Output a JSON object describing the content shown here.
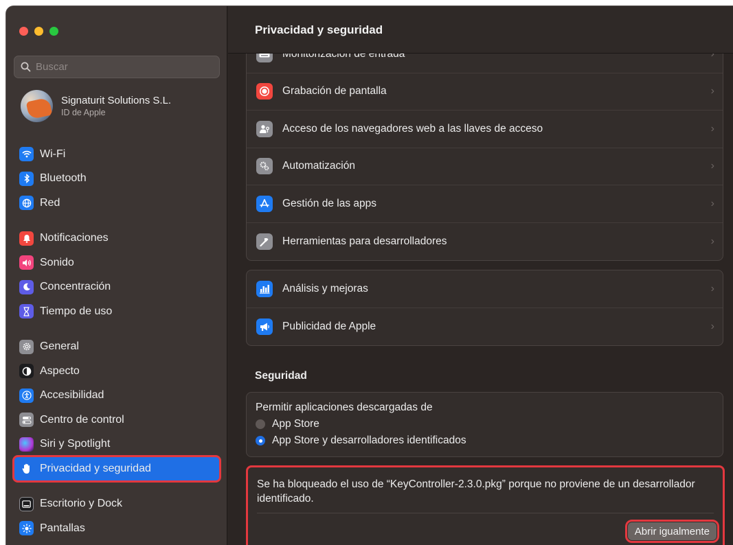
{
  "window": {
    "title": "Privacidad y seguridad"
  },
  "search": {
    "placeholder": "Buscar"
  },
  "account": {
    "name": "Signaturit Solutions S.L.",
    "subtitle": "ID de Apple"
  },
  "sidebar": {
    "items": [
      {
        "label": "Wi-Fi",
        "icon": "wifi-icon",
        "color": "#1f7bf2"
      },
      {
        "label": "Bluetooth",
        "icon": "bluetooth-icon",
        "color": "#1f7bf2"
      },
      {
        "label": "Red",
        "icon": "globe-icon",
        "color": "#1f7bf2"
      },
      {
        "label": "Notificaciones",
        "icon": "bell-icon",
        "color": "#f2473f"
      },
      {
        "label": "Sonido",
        "icon": "speaker-icon",
        "color": "#f2447d"
      },
      {
        "label": "Concentración",
        "icon": "moon-icon",
        "color": "#5e5ce6"
      },
      {
        "label": "Tiempo de uso",
        "icon": "hourglass-icon",
        "color": "#5e5ce6"
      },
      {
        "label": "General",
        "icon": "gear-icon",
        "color": "#8e8e93"
      },
      {
        "label": "Aspecto",
        "icon": "appearance-icon",
        "color": "#1c1c1e"
      },
      {
        "label": "Accesibilidad",
        "icon": "accessibility-icon",
        "color": "#1f7bf2"
      },
      {
        "label": "Centro de control",
        "icon": "toggles-icon",
        "color": "#8e8e93"
      },
      {
        "label": "Siri y Spotlight",
        "icon": "siri-icon",
        "color": "#b03ad6"
      },
      {
        "label": "Privacidad y seguridad",
        "icon": "hand-icon",
        "color": "#1f7bf2"
      },
      {
        "label": "Escritorio y Dock",
        "icon": "dock-icon",
        "color": "#1c1c1e"
      },
      {
        "label": "Pantallas",
        "icon": "sun-icon",
        "color": "#1f7bf2"
      }
    ],
    "active_index": 12
  },
  "privacy_rows_1": [
    {
      "label": "Monitorización de entrada",
      "icon": "keyboard-icon",
      "color": "#8e8e93"
    },
    {
      "label": "Grabación de pantalla",
      "icon": "record-icon",
      "color": "#f2473f"
    },
    {
      "label": "Acceso de los navegadores web a las llaves de acceso",
      "icon": "person-key-icon",
      "color": "#8e8e93"
    },
    {
      "label": "Automatización",
      "icon": "gears-icon",
      "color": "#8e8e93"
    },
    {
      "label": "Gestión de las apps",
      "icon": "app-store-icon",
      "color": "#1f7bf2"
    },
    {
      "label": "Herramientas para desarrolladores",
      "icon": "hammer-icon",
      "color": "#8e8e93"
    }
  ],
  "privacy_rows_2": [
    {
      "label": "Análisis y mejoras",
      "icon": "chart-bars-icon",
      "color": "#1f7bf2"
    },
    {
      "label": "Publicidad de Apple",
      "icon": "megaphone-icon",
      "color": "#1f7bf2"
    }
  ],
  "security": {
    "title": "Seguridad",
    "allow_label": "Permitir aplicaciones descargadas de",
    "options": [
      {
        "label": "App Store",
        "checked": false
      },
      {
        "label": "App Store y desarrolladores identificados",
        "checked": true
      }
    ],
    "blocked_message": "Se ha bloqueado el uso de “KeyController-2.3.0.pkg” porque no proviene de un desarrollador identificado.",
    "open_button": "Abrir igualmente"
  },
  "chevron": "›"
}
